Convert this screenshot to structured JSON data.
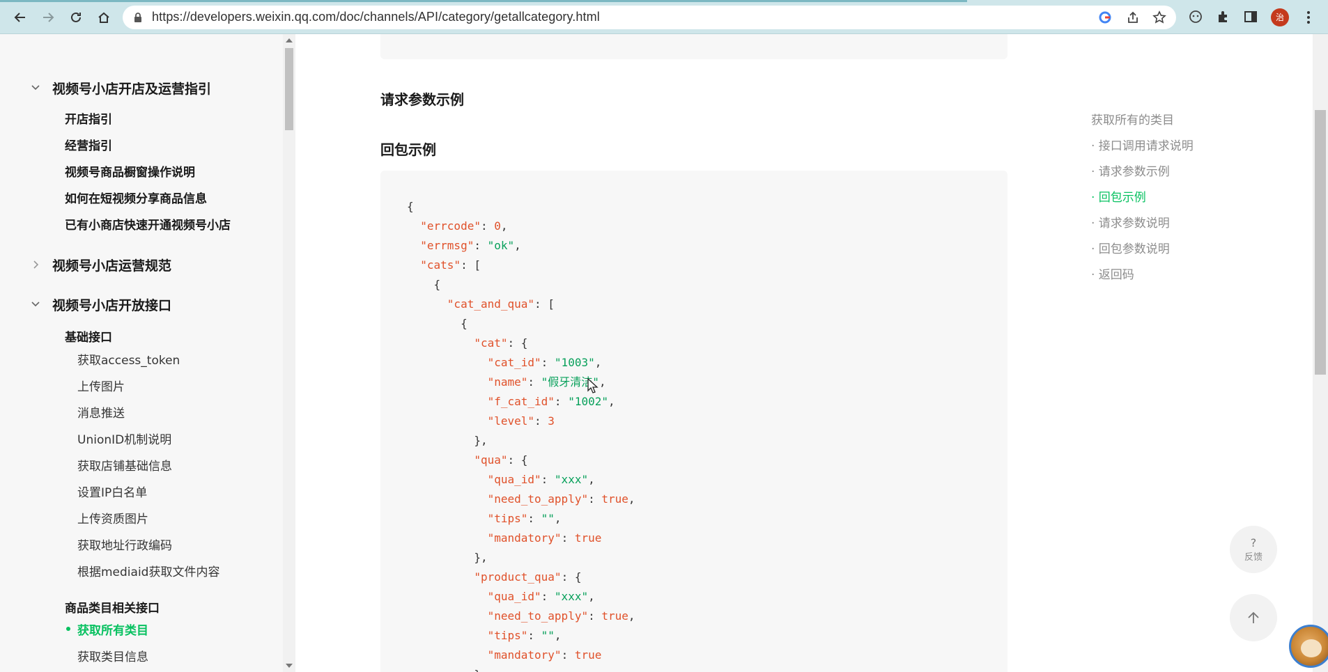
{
  "browser": {
    "url": "https://developers.weixin.qq.com/doc/channels/API/category/getallcategory.html",
    "profile_initial": "治"
  },
  "sidebar": {
    "sections": [
      {
        "title": "视频号小店开店及运营指引",
        "expanded": true,
        "items": [
          "开店指引",
          "经营指引",
          "视频号商品橱窗操作说明",
          "如何在短视频分享商品信息",
          "已有小商店快速开通视频号小店"
        ]
      },
      {
        "title": "视频号小店运营规范",
        "expanded": false
      },
      {
        "title": "视频号小店开放接口",
        "expanded": true,
        "groups": [
          {
            "title": "基础接口",
            "items": [
              "获取access_token",
              "上传图片",
              "消息推送",
              "UnionID机制说明",
              "获取店铺基础信息",
              "设置IP白名单",
              "上传资质图片",
              "获取地址行政编码",
              "根据mediaid获取文件内容"
            ]
          },
          {
            "title": "商品类目相关接口",
            "items": [
              "获取所有类目",
              "获取类目信息"
            ],
            "active_index": 0
          }
        ]
      }
    ]
  },
  "main": {
    "heading_request_example": "请求参数示例",
    "heading_response_example": "回包示例"
  },
  "code": {
    "lines": [
      {
        "indent": 0,
        "parts": [
          [
            "p",
            "{"
          ]
        ]
      },
      {
        "indent": 1,
        "parts": [
          [
            "k",
            "\"errcode\""
          ],
          [
            "p",
            ": "
          ],
          [
            "n",
            "0"
          ],
          [
            "p",
            ","
          ]
        ]
      },
      {
        "indent": 1,
        "parts": [
          [
            "k",
            "\"errmsg\""
          ],
          [
            "p",
            ": "
          ],
          [
            "s",
            "\"ok\""
          ],
          [
            "p",
            ","
          ]
        ]
      },
      {
        "indent": 1,
        "parts": [
          [
            "k",
            "\"cats\""
          ],
          [
            "p",
            ": ["
          ]
        ]
      },
      {
        "indent": 2,
        "parts": [
          [
            "p",
            "{"
          ]
        ]
      },
      {
        "indent": 3,
        "parts": [
          [
            "k",
            "\"cat_and_qua\""
          ],
          [
            "p",
            ": ["
          ]
        ]
      },
      {
        "indent": 4,
        "parts": [
          [
            "p",
            "{"
          ]
        ]
      },
      {
        "indent": 5,
        "parts": [
          [
            "k",
            "\"cat\""
          ],
          [
            "p",
            ": {"
          ]
        ]
      },
      {
        "indent": 6,
        "parts": [
          [
            "k",
            "\"cat_id\""
          ],
          [
            "p",
            ": "
          ],
          [
            "s",
            "\"1003\""
          ],
          [
            "p",
            ","
          ]
        ]
      },
      {
        "indent": 6,
        "parts": [
          [
            "k",
            "\"name\""
          ],
          [
            "p",
            ": "
          ],
          [
            "s",
            "\"假牙清洁\""
          ],
          [
            "p",
            ","
          ]
        ]
      },
      {
        "indent": 6,
        "parts": [
          [
            "k",
            "\"f_cat_id\""
          ],
          [
            "p",
            ": "
          ],
          [
            "s",
            "\"1002\""
          ],
          [
            "p",
            ","
          ]
        ]
      },
      {
        "indent": 6,
        "parts": [
          [
            "k",
            "\"level\""
          ],
          [
            "p",
            ": "
          ],
          [
            "n",
            "3"
          ]
        ]
      },
      {
        "indent": 5,
        "parts": [
          [
            "p",
            "},"
          ]
        ]
      },
      {
        "indent": 5,
        "parts": [
          [
            "k",
            "\"qua\""
          ],
          [
            "p",
            ": {"
          ]
        ]
      },
      {
        "indent": 6,
        "parts": [
          [
            "k",
            "\"qua_id\""
          ],
          [
            "p",
            ": "
          ],
          [
            "s",
            "\"xxx\""
          ],
          [
            "p",
            ","
          ]
        ]
      },
      {
        "indent": 6,
        "parts": [
          [
            "k",
            "\"need_to_apply\""
          ],
          [
            "p",
            ": "
          ],
          [
            "n",
            "true"
          ],
          [
            "p",
            ","
          ]
        ]
      },
      {
        "indent": 6,
        "parts": [
          [
            "k",
            "\"tips\""
          ],
          [
            "p",
            ": "
          ],
          [
            "s",
            "\"\""
          ],
          [
            "p",
            ","
          ]
        ]
      },
      {
        "indent": 6,
        "parts": [
          [
            "k",
            "\"mandatory\""
          ],
          [
            "p",
            ": "
          ],
          [
            "n",
            "true"
          ]
        ]
      },
      {
        "indent": 5,
        "parts": [
          [
            "p",
            "},"
          ]
        ]
      },
      {
        "indent": 5,
        "parts": [
          [
            "k",
            "\"product_qua\""
          ],
          [
            "p",
            ": {"
          ]
        ]
      },
      {
        "indent": 6,
        "parts": [
          [
            "k",
            "\"qua_id\""
          ],
          [
            "p",
            ": "
          ],
          [
            "s",
            "\"xxx\""
          ],
          [
            "p",
            ","
          ]
        ]
      },
      {
        "indent": 6,
        "parts": [
          [
            "k",
            "\"need_to_apply\""
          ],
          [
            "p",
            ": "
          ],
          [
            "n",
            "true"
          ],
          [
            "p",
            ","
          ]
        ]
      },
      {
        "indent": 6,
        "parts": [
          [
            "k",
            "\"tips\""
          ],
          [
            "p",
            ": "
          ],
          [
            "s",
            "\"\""
          ],
          [
            "p",
            ","
          ]
        ]
      },
      {
        "indent": 6,
        "parts": [
          [
            "k",
            "\"mandatory\""
          ],
          [
            "p",
            ": "
          ],
          [
            "n",
            "true"
          ]
        ]
      },
      {
        "indent": 5,
        "parts": [
          [
            "p",
            "}"
          ]
        ]
      }
    ]
  },
  "toc": {
    "title": "获取所有的类目",
    "items": [
      "· 接口调用请求说明",
      "· 请求参数示例",
      "· 回包示例",
      "· 请求参数说明",
      "· 回包参数说明",
      "· 返回码"
    ],
    "active_index": 2
  },
  "floating": {
    "feedback_symbol": "?",
    "feedback_label": "反馈"
  },
  "colors": {
    "accent": "#07c160",
    "code_key": "#e0512a",
    "code_string": "#07a05a",
    "chrome_bg": "#cfe6ea"
  }
}
